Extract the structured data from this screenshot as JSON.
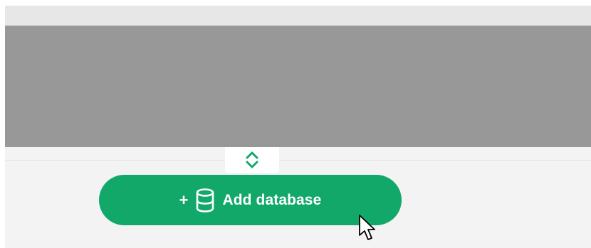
{
  "toolbar": {
    "add_database": {
      "prefix": "+",
      "icon": "database-icon",
      "label": "Add database"
    }
  },
  "resize_handle": {
    "icon": "chevron-up-down-icon"
  },
  "colors": {
    "accent_green": "#12a86a",
    "panel_gray": "#989898",
    "background": "#f3f3f3"
  }
}
